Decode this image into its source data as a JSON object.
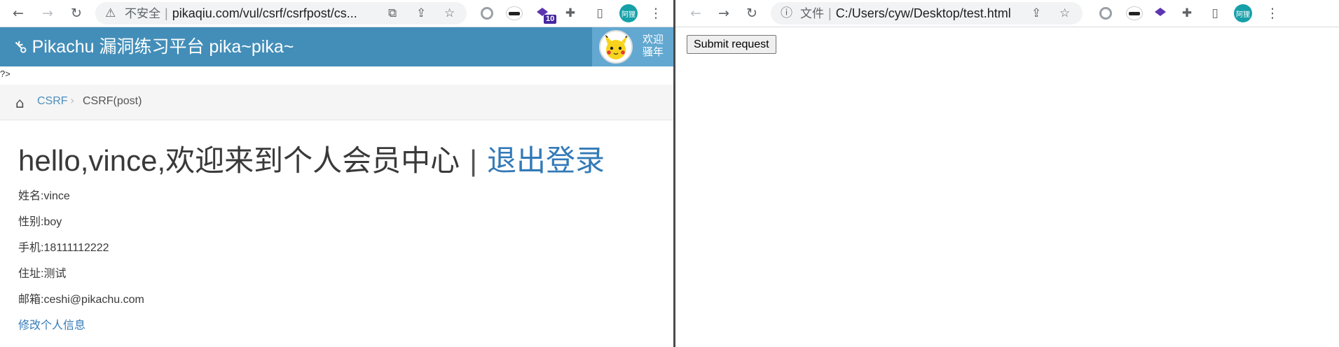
{
  "left_browser": {
    "back_icon": "←",
    "forward_icon": "→",
    "reload_icon": "↻",
    "security_icon": "⚠",
    "security_label": "不安全",
    "url": "pikaqiu.com/vul/csrf/csrfpost/cs...",
    "translate_icon": "⧉",
    "share_icon": "⇪",
    "star_icon": "☆",
    "ext_badge": "10",
    "puzzle_icon": "✚",
    "sidepanel_icon": "▯",
    "profile_label": "阿狸",
    "menu_icon": "⋮"
  },
  "pikachu": {
    "brand_icon": "⚷",
    "brand_title": "Pikachu 漏洞练习平台 pika~pika~",
    "welcome_line1": "欢迎",
    "welcome_line2": "骚年",
    "stray_text": "?>",
    "breadcrumb_home_icon": "⌂",
    "breadcrumb_link": "CSRF",
    "breadcrumb_sep": "›",
    "breadcrumb_current": "CSRF(post)",
    "title_greeting": "hello,vince,欢迎来到个人会员中心",
    "title_sep": "|",
    "title_logout": "退出登录",
    "fields": [
      "姓名:vince",
      "性别:boy",
      "手机:18111112222",
      "住址:测试",
      "邮箱:ceshi@pikachu.com"
    ],
    "edit_link": "修改个人信息"
  },
  "right_browser": {
    "back_icon": "←",
    "forward_icon": "→",
    "reload_icon": "↻",
    "info_icon": "ⓘ",
    "scheme_label": "文件",
    "url": "C:/Users/cyw/Desktop/test.html",
    "share_icon": "⇪",
    "star_icon": "☆",
    "puzzle_icon": "✚",
    "sidepanel_icon": "▯",
    "profile_label": "阿狸",
    "menu_icon": "⋮"
  },
  "test_page": {
    "submit_label": "Submit request"
  },
  "colors": {
    "header_bg": "#438eb9",
    "link": "#337ab7",
    "breadcrumb_bg": "#f5f5f5"
  }
}
